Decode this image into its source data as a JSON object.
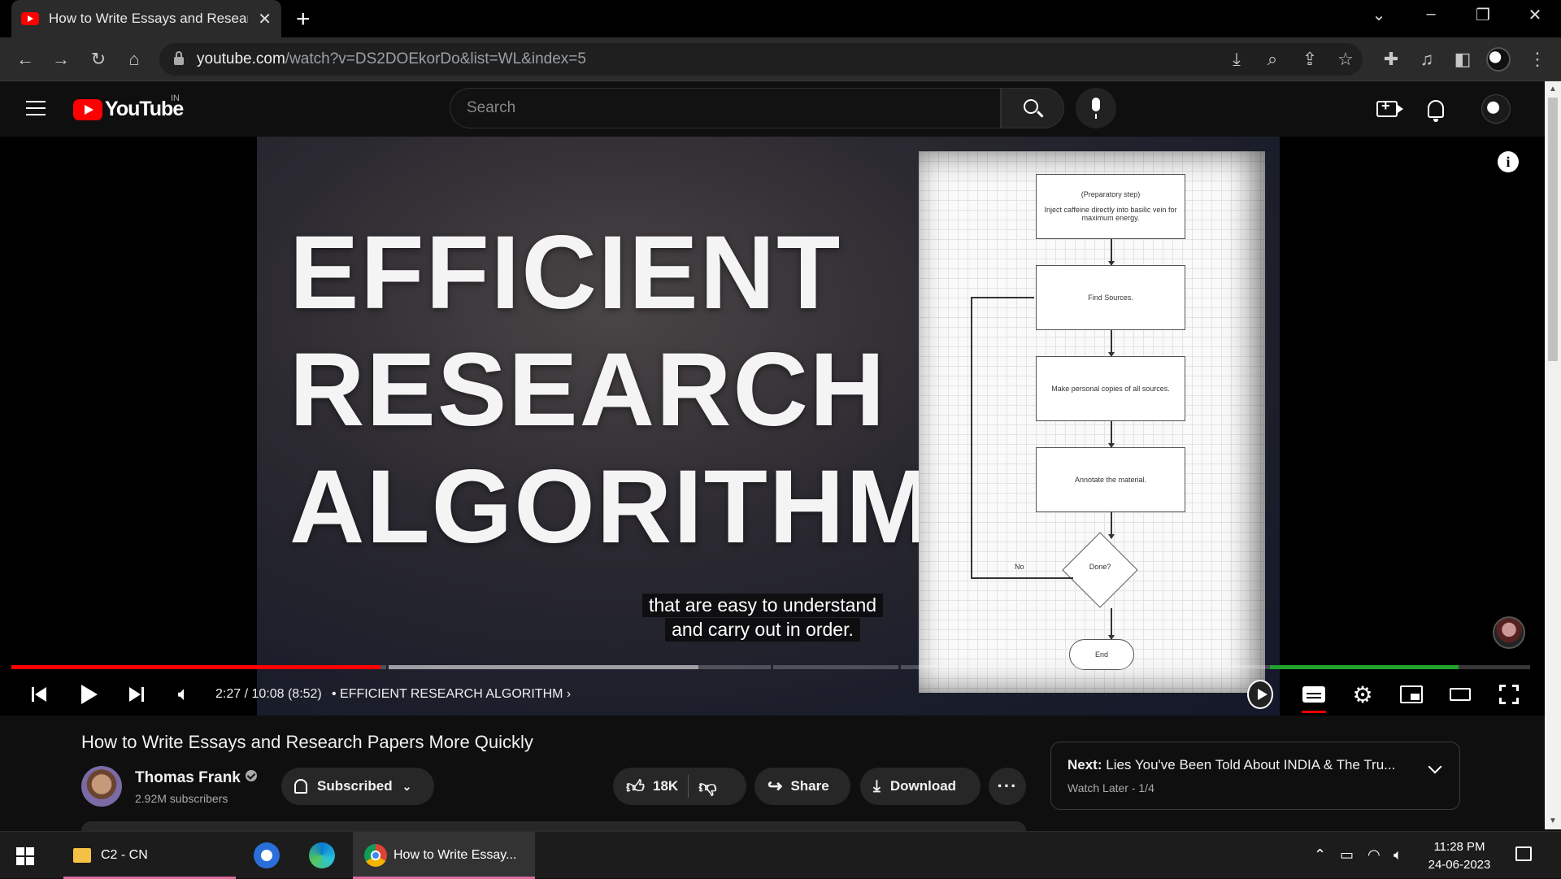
{
  "browser": {
    "tab_title": "How to Write Essays and Research Papers More Quickly",
    "url_host": "youtube.com",
    "url_path": "/watch?v=DS2DOEkorDo&list=WL&index=5"
  },
  "youtube_header": {
    "logo_text": "YouTube",
    "country_code": "IN",
    "search_placeholder": "Search"
  },
  "video": {
    "thumbnail_lines": [
      "EFFICIENT",
      "RESEARCH",
      "ALGORITHM"
    ],
    "flowchart": {
      "step1_title": "(Preparatory step)",
      "step1_text": "Inject caffeine directly into basilic vein for maximum energy.",
      "step2": "Find Sources.",
      "step3": "Make personal copies of all sources.",
      "step4": "Annotate the material.",
      "decision": "Done?",
      "no_label": "No",
      "end": "End"
    },
    "subtitle_line1": "that are easy to understand",
    "subtitle_line2": "and carry out in order.",
    "progress_fraction": 0.243
  },
  "player_controls": {
    "time": "2:27 / 10:08 (8:52)",
    "chapter": "• EFFICIENT RESEARCH ALGORITHM ›"
  },
  "video_info": {
    "title": "How to Write Essays and Research Papers More Quickly",
    "channel_name": "Thomas Frank",
    "subscribers": "2.92M subscribers",
    "subscribe_label": "Subscribed",
    "likes": "18K",
    "share_label": "Share",
    "download_label": "Download"
  },
  "next_card": {
    "prefix": "Next:",
    "title": "Lies You've Been Told About INDIA & The Tru...",
    "sub": "Watch Later - 1/4"
  },
  "taskbar": {
    "folder_label": "C2 - CN",
    "chrome_label": "How to Write Essay...",
    "time": "11:28 PM",
    "date": "24-06-2023"
  },
  "colors": {
    "youtube_red": "#ff0000",
    "sponsor_green": "#1fa32d",
    "background": "#0f0f0f"
  }
}
